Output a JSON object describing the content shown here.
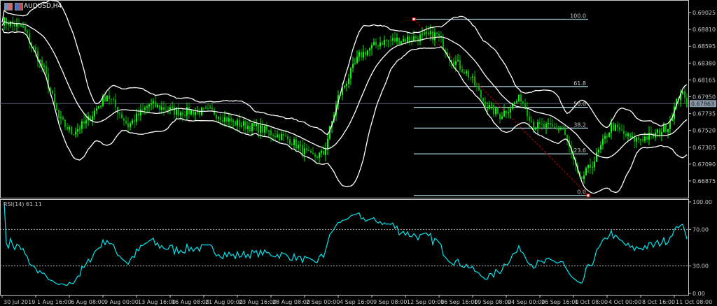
{
  "window": {
    "symbol_title": "AUDUSD,H4",
    "icons": [
      "chart-window-icon",
      "chart-settings-icon"
    ]
  },
  "colors": {
    "background": "#000000",
    "bull": "#00ff00",
    "bear": "#00b000",
    "bands": "#ffffff",
    "fibo": "#b0d4e0",
    "trendline": "#c00000",
    "rsi": "#00e5ee",
    "axis": "#c8c8c8",
    "price_line": "#5a6470"
  },
  "chart_data": [
    {
      "type": "candlestick",
      "title": "AUDUSD,H4",
      "ylim": [
        0.6668,
        0.691
      ],
      "y_ticks": [
        "0.69025",
        "0.68810",
        "0.68595",
        "0.68380",
        "0.68165",
        "0.67950",
        "0.67735",
        "0.67520",
        "0.67305",
        "0.67090",
        "0.66875"
      ],
      "x_ticks": [
        "30 Jul 2019",
        "1 Aug 16:00",
        "6 Aug 08:00",
        "9 Aug 00:00",
        "13 Aug 16:00",
        "16 Aug 08:00",
        "21 Aug 00:00",
        "23 Aug 16:00",
        "28 Aug 08:00",
        "2 Sep 00:00",
        "4 Sep 16:00",
        "9 Sep 08:00",
        "12 Sep 00:00",
        "16 Sep 16:00",
        "19 Sep 08:00",
        "24 Sep 00:00",
        "26 Sep 16:00",
        "1 Oct 08:00",
        "4 Oct 00:00",
        "8 Oct 16:00",
        "11 Oct 08:00"
      ],
      "bars_per_x_tick": 16,
      "current_price": "0.67863",
      "close_path": [
        [
          0,
          0.6892
        ],
        [
          10,
          0.6883
        ],
        [
          20,
          0.6829
        ],
        [
          27,
          0.6767
        ],
        [
          33,
          0.6749
        ],
        [
          40,
          0.6762
        ],
        [
          50,
          0.6798
        ],
        [
          60,
          0.6758
        ],
        [
          70,
          0.6785
        ],
        [
          83,
          0.6776
        ],
        [
          100,
          0.6776
        ],
        [
          110,
          0.6762
        ],
        [
          123,
          0.6754
        ],
        [
          137,
          0.674
        ],
        [
          147,
          0.6718
        ],
        [
          153,
          0.6722
        ],
        [
          160,
          0.6794
        ],
        [
          170,
          0.6847
        ],
        [
          180,
          0.6865
        ],
        [
          193,
          0.6869
        ],
        [
          207,
          0.6874
        ],
        [
          213,
          0.6847
        ],
        [
          223,
          0.682
        ],
        [
          230,
          0.6785
        ],
        [
          237,
          0.6771
        ],
        [
          247,
          0.6794
        ],
        [
          253,
          0.6758
        ],
        [
          267,
          0.6754
        ],
        [
          275,
          0.6687
        ],
        [
          282,
          0.6714
        ],
        [
          290,
          0.6758
        ],
        [
          300,
          0.674
        ],
        [
          310,
          0.6745
        ],
        [
          317,
          0.6758
        ],
        [
          323,
          0.6802
        ],
        [
          326,
          0.6786
        ]
      ],
      "indicators": [
        "Bollinger Bands(20,2)"
      ],
      "fibonacci": {
        "high": 0.6894,
        "low": 0.6669,
        "levels": [
          "100.0",
          "61.8",
          "50.0",
          "38.2",
          "23.6",
          "0.0"
        ],
        "ratios": [
          1.0,
          0.618,
          0.5,
          0.382,
          0.236,
          0.0
        ]
      }
    },
    {
      "type": "line",
      "title": "RSI(14) 61.11",
      "name": "RSI(14)",
      "last_value": "61.11",
      "ylim": [
        0,
        100
      ],
      "y_ticks": [
        "100.00",
        "70.00",
        "30.00",
        "0.00"
      ],
      "levels": [
        70,
        30
      ]
    }
  ]
}
